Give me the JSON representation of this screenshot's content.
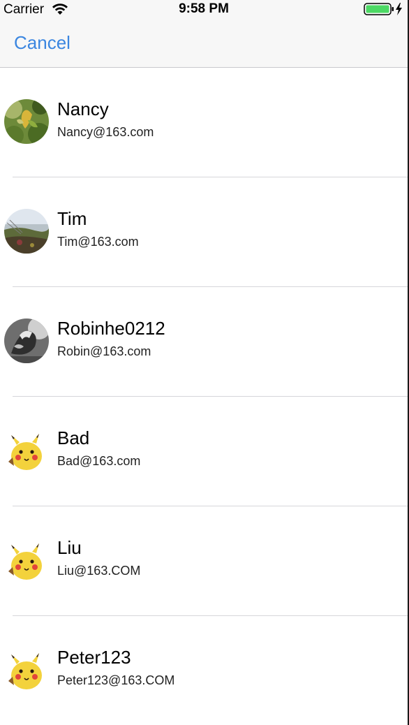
{
  "status_bar": {
    "carrier": "Carrier",
    "time": "9:58 PM",
    "battery_color": "#4cd964"
  },
  "nav": {
    "cancel_label": "Cancel",
    "tint_color": "#3b86e0"
  },
  "contacts": [
    {
      "name": "Nancy",
      "email": "Nancy@163.com",
      "avatar": "plant-photo"
    },
    {
      "name": "Tim",
      "email": "Tim@163.com",
      "avatar": "landscape-photo"
    },
    {
      "name": "Robinhe0212",
      "email": "Robin@163.com",
      "avatar": "bw-photo"
    },
    {
      "name": "Bad",
      "email": "Bad@163.com",
      "avatar": "pikachu"
    },
    {
      "name": "Liu",
      "email": "Liu@163.COM",
      "avatar": "pikachu"
    },
    {
      "name": "Peter123",
      "email": "Peter123@163.COM",
      "avatar": "pikachu"
    }
  ]
}
